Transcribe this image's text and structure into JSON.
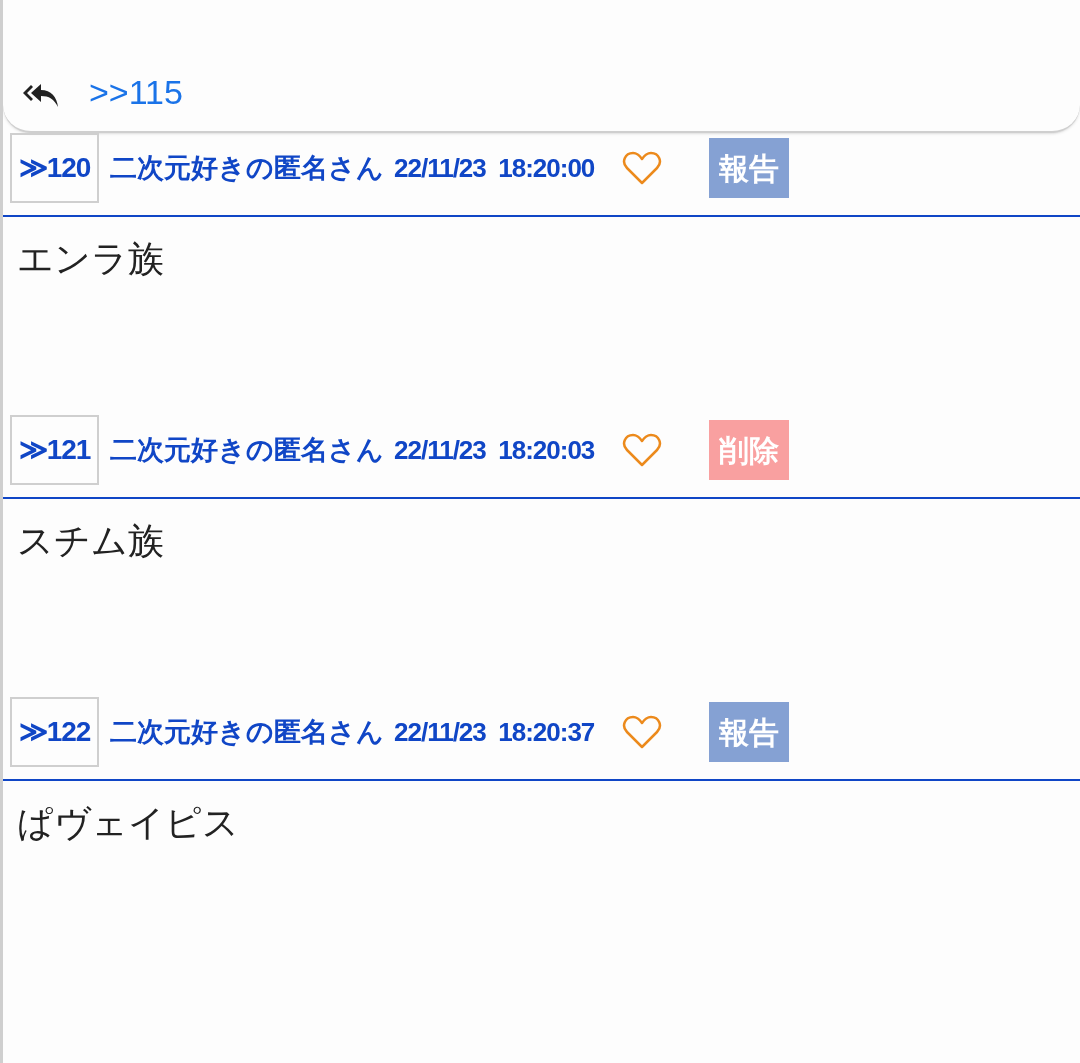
{
  "reply_card": {
    "anchor": ">>115"
  },
  "posts": [
    {
      "number": "≫120",
      "name": "二次元好きの匿名さん",
      "date": "22/11/23  18:20:00",
      "action": {
        "kind": "report",
        "label": "報告"
      },
      "body": "エンラ族"
    },
    {
      "number": "≫121",
      "name": "二次元好きの匿名さん",
      "date": "22/11/23  18:20:03",
      "action": {
        "kind": "delete",
        "label": "削除"
      },
      "body": "スチム族"
    },
    {
      "number": "≫122",
      "name": "二次元好きの匿名さん",
      "date": "22/11/23  18:20:37",
      "action": {
        "kind": "report",
        "label": "報告"
      },
      "body": "ぱヴェイピス"
    }
  ]
}
